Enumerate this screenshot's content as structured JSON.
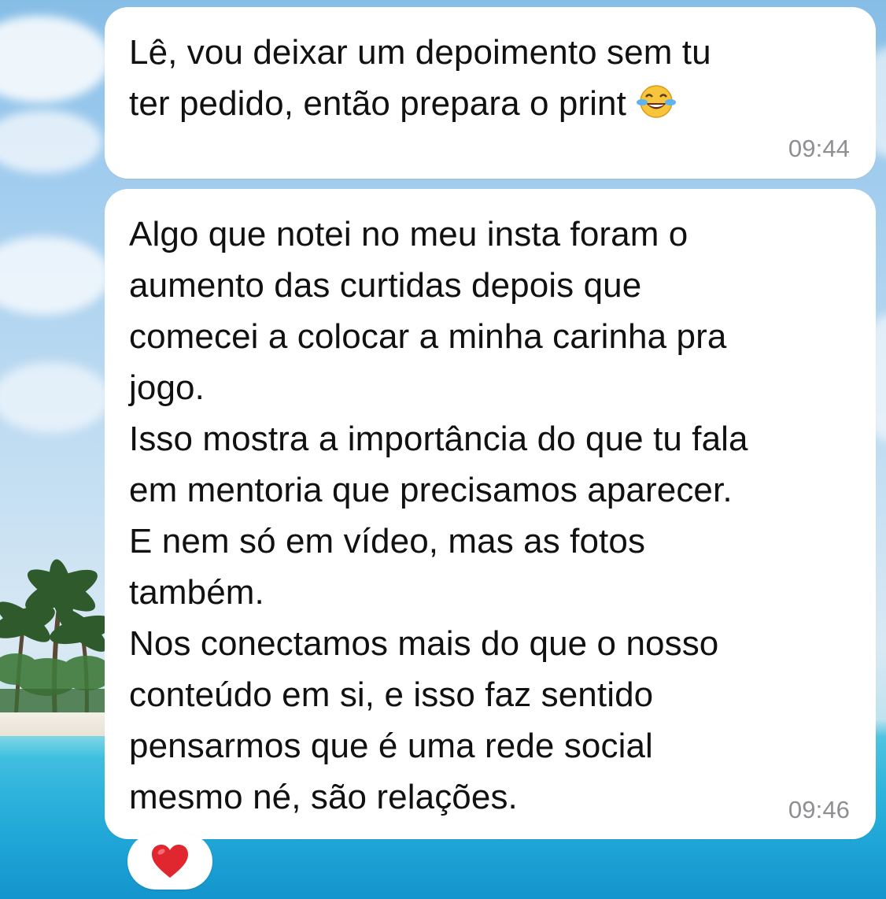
{
  "messages": [
    {
      "text": "Lê, vou deixar um depoimento sem tu\nter pedido, então prepara o print",
      "emoji": "face-with-tears-of-joy-icon",
      "time": "09:44"
    },
    {
      "text": "Algo que notei no meu insta foram o\naumento das curtidas depois que\ncomecei a colocar a minha carinha pra\njogo.\nIsso mostra a importância do que tu fala\nem mentoria que precisamos aparecer.\nE nem só em vídeo, mas as fotos\ntambém.\nNos conectamos mais do que o nosso\nconteúdo em si, e isso faz sentido\npensarmos que é uma rede social\nmesmo né, são relações.",
      "time": "09:46"
    }
  ],
  "reaction": {
    "icon": "red-heart-icon",
    "color": "#e0262f"
  },
  "colors": {
    "bubble": "#ffffff",
    "text": "#111111",
    "timestamp": "#8e8e93"
  }
}
